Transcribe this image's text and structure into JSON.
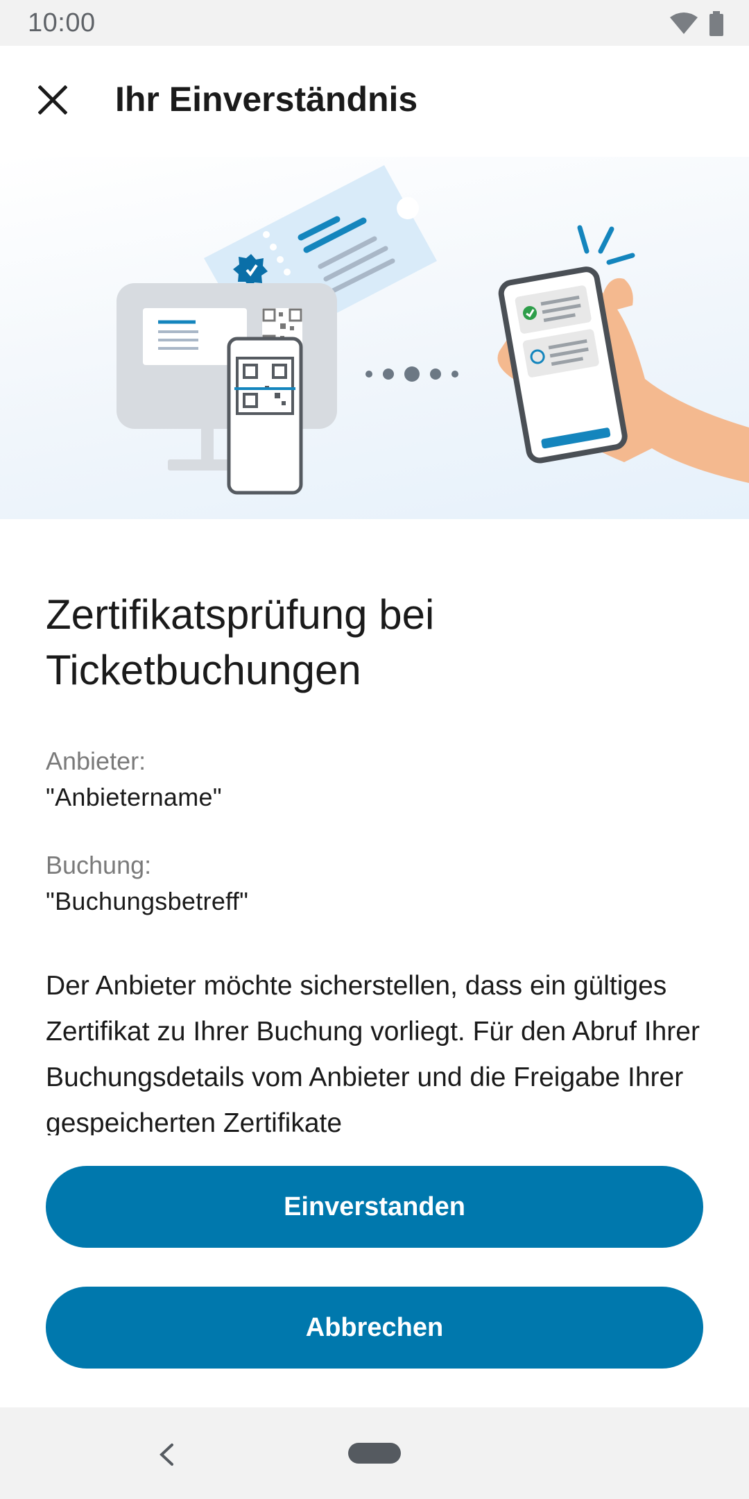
{
  "status_bar": {
    "time": "10:00",
    "icons": [
      "wifi-icon",
      "battery-icon"
    ]
  },
  "app_bar": {
    "title": "Ihr Einverständnis",
    "close_icon": "close-icon"
  },
  "hero": {
    "illustration": "ticket-booking-certificate-check-illustration"
  },
  "content": {
    "headline": "Zertifikatsprüfung bei Ticketbuchungen",
    "provider_label": "Anbieter:",
    "provider_value": "\"Anbietername\"",
    "booking_label": "Buchung:",
    "booking_value": "\"Buchungsbetreff\"",
    "body": "Der Anbieter möchte sicherstellen, dass ein gültiges Zertifikat zu Ihrer Buchung vorliegt. Für den Abruf Ihrer Buchungsdetails vom Anbieter und die Freigabe Ihrer gespeicherten Zertifikate"
  },
  "actions": {
    "agree_label": "Einverstanden",
    "cancel_label": "Abbrechen"
  },
  "nav_bar": {
    "back_icon": "back-chevron-icon",
    "home_icon": "home-pill-icon"
  },
  "colors": {
    "primary": "#0078ad",
    "status_bar_bg": "#f2f2f2",
    "text_primary": "#1a1a1a",
    "text_secondary": "#7a7a7a"
  }
}
